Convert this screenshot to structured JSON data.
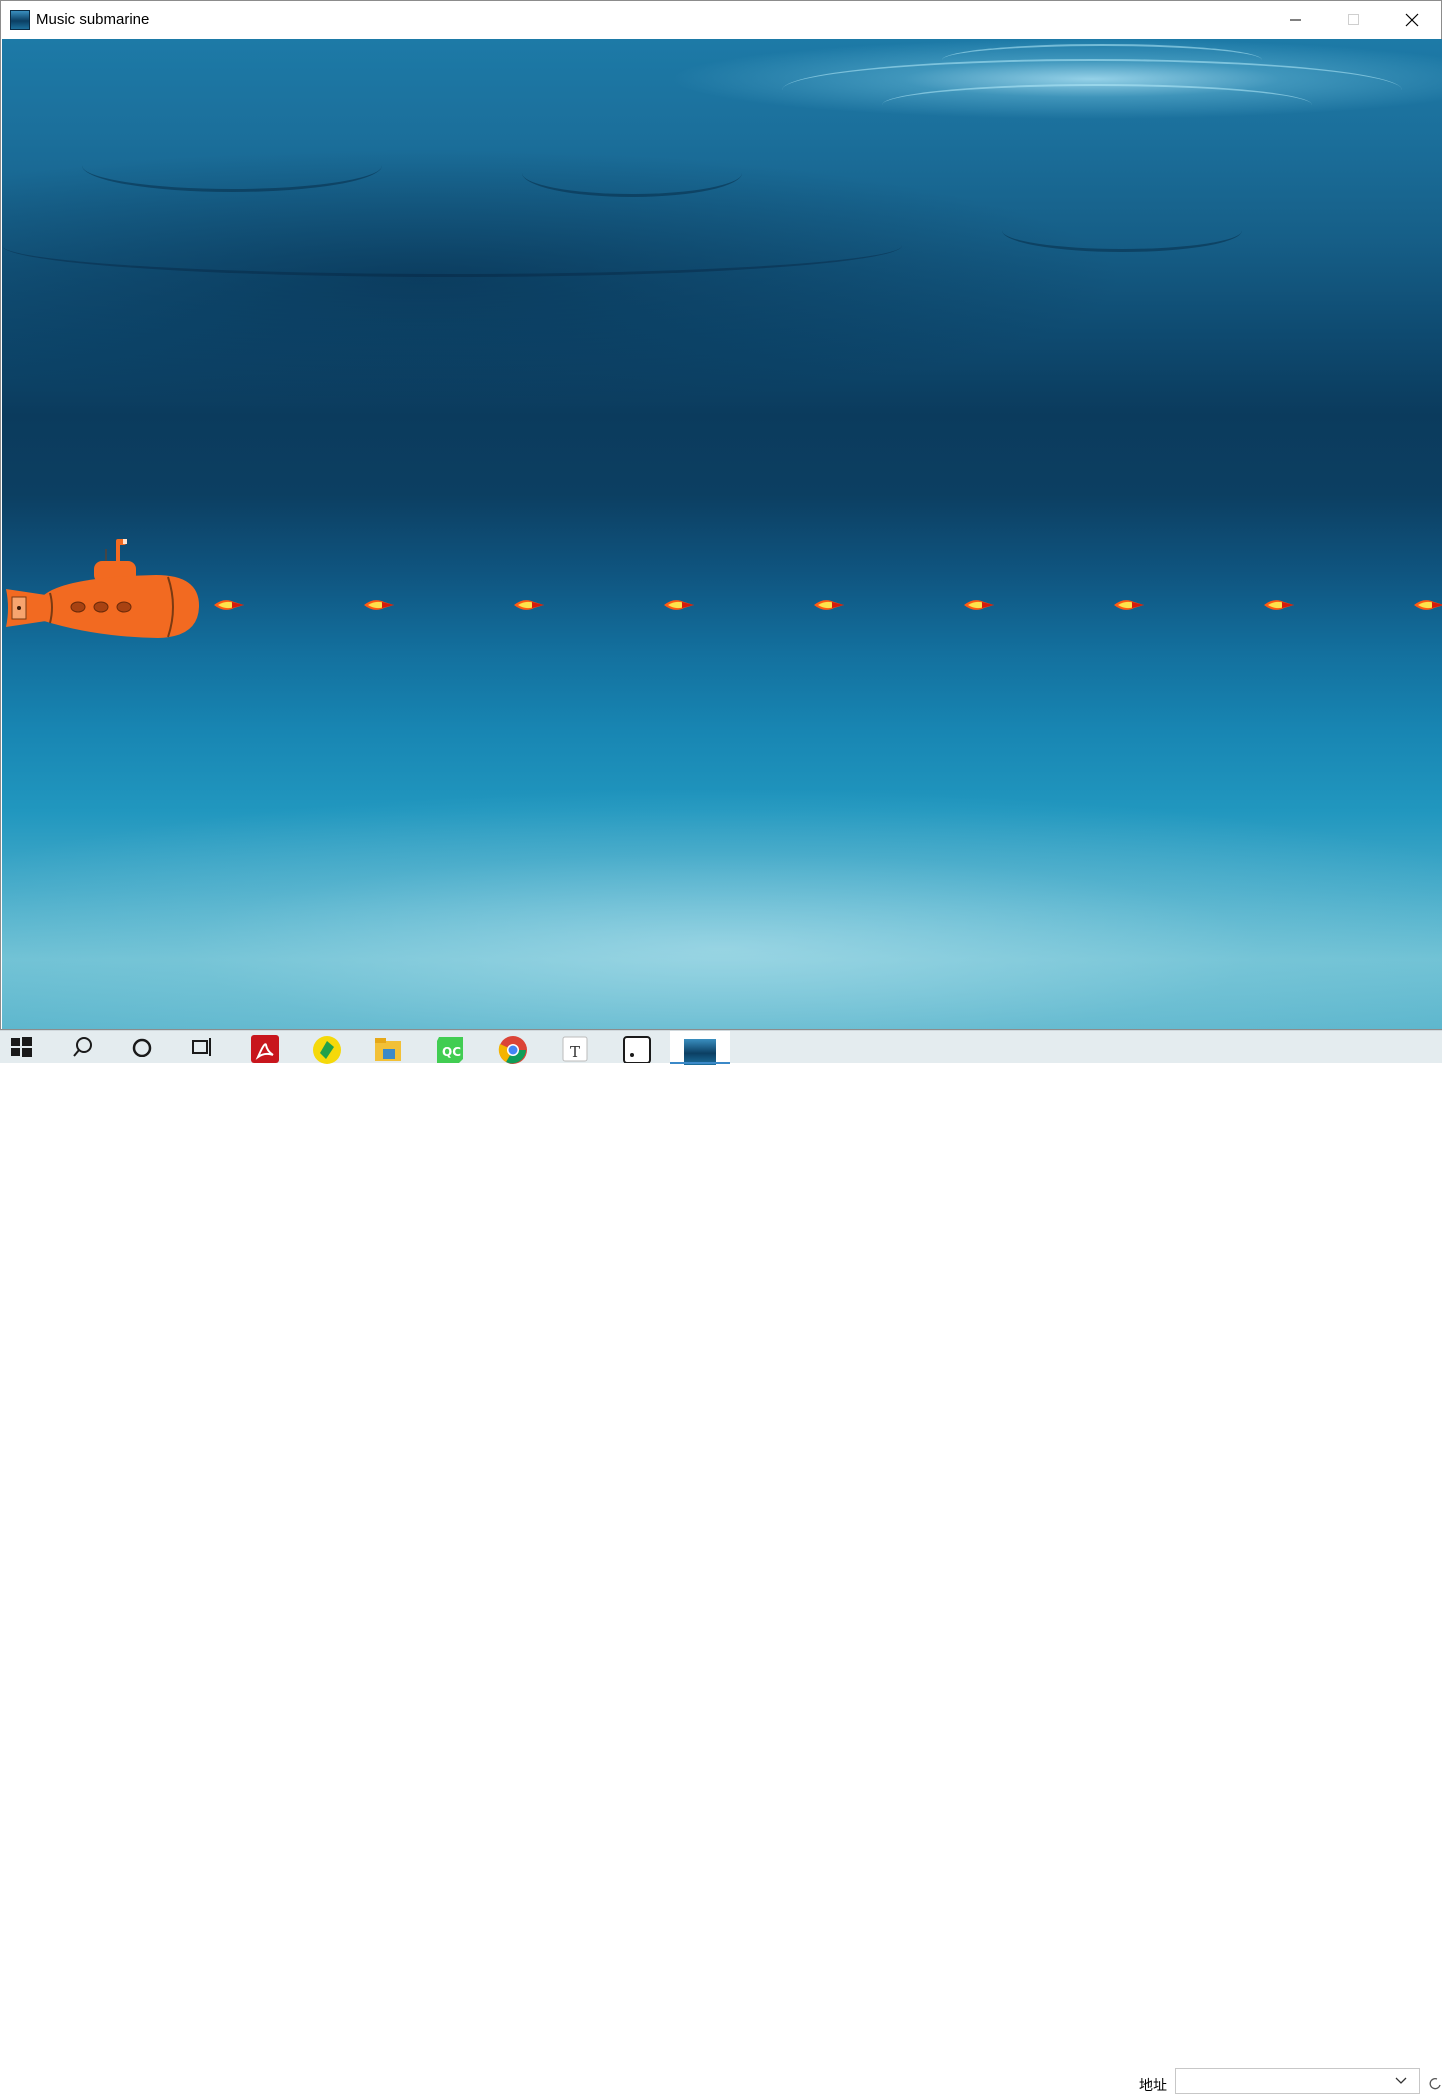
{
  "window": {
    "title": "Music submarine",
    "controls": {
      "minimize": "minimize",
      "maximize": "maximize",
      "close": "close"
    }
  },
  "game": {
    "submarine": {
      "color": "#f26a21",
      "portholes": 3
    },
    "torpedo_count": 9,
    "torpedo_colors": {
      "core": "#ffe14a",
      "flame": "#ff5a12",
      "tip": "#d41b0b"
    }
  },
  "taskbar": {
    "icons": [
      "windows-start-icon",
      "search-icon",
      "cortana-icon",
      "task-view-icon",
      "acrobat-icon",
      "sync-app-icon",
      "file-explorer-icon",
      "qt-creator-icon",
      "chrome-icon",
      "typora-icon",
      "terminal-icon",
      "music-submarine-icon"
    ],
    "address_label": "地址",
    "address_value": ""
  },
  "colors": {
    "accent": "#3b89c8",
    "ocean_deep": "#0b3b5d",
    "ocean_light": "#6ec1d4"
  }
}
